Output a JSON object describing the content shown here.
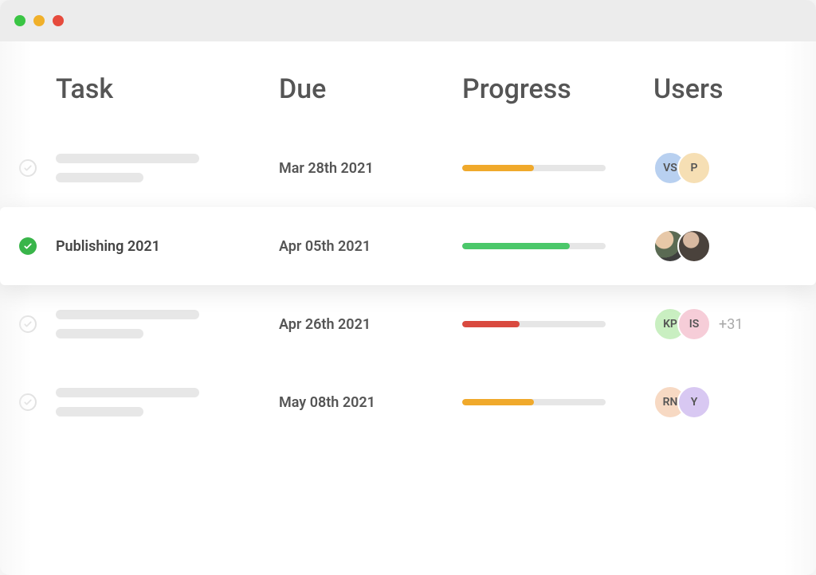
{
  "columns": {
    "task": "Task",
    "due": "Due",
    "progress": "Progress",
    "users": "Users"
  },
  "colors": {
    "orange": "#f0a92b",
    "green": "#4bc86a",
    "red": "#d94a3f"
  },
  "rows": [
    {
      "done": false,
      "skeleton": true,
      "name": "",
      "due": "Mar 28th 2021",
      "progress_pct": 50,
      "progress_color": "#f0a92b",
      "users": [
        {
          "label": "VS",
          "bg": "#b8d0f0"
        },
        {
          "label": "P",
          "bg": "#f6dfb4"
        }
      ],
      "overflow": ""
    },
    {
      "done": true,
      "skeleton": false,
      "name": "Publishing 2021",
      "due": "Apr 05th 2021",
      "progress_pct": 75,
      "progress_color": "#4bc86a",
      "users": [
        {
          "label": "",
          "bg": "",
          "photo": "photo1"
        },
        {
          "label": "",
          "bg": "",
          "photo": "photo2"
        }
      ],
      "overflow": ""
    },
    {
      "done": false,
      "skeleton": true,
      "name": "",
      "due": "Apr 26th 2021",
      "progress_pct": 40,
      "progress_color": "#d94a3f",
      "users": [
        {
          "label": "KP",
          "bg": "#c9efc1"
        },
        {
          "label": "IS",
          "bg": "#f6cdd8"
        }
      ],
      "overflow": "+31"
    },
    {
      "done": false,
      "skeleton": true,
      "name": "",
      "due": "May 08th 2021",
      "progress_pct": 50,
      "progress_color": "#f0a92b",
      "users": [
        {
          "label": "RN",
          "bg": "#f7d9c3"
        },
        {
          "label": "Y",
          "bg": "#d8c8f2"
        }
      ],
      "overflow": ""
    }
  ]
}
